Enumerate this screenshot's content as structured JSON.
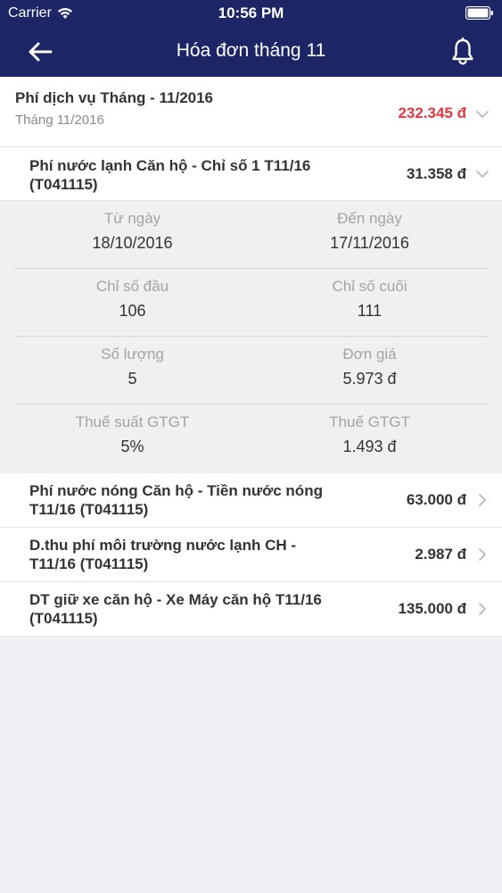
{
  "status_bar": {
    "carrier": "Carrier",
    "time": "10:56 PM"
  },
  "nav": {
    "title": "Hóa đơn tháng 11"
  },
  "section": {
    "title": "Phí dịch vụ Tháng - 11/2016",
    "subtitle": "Tháng 11/2016",
    "amount": "232.345 đ"
  },
  "expanded_item": {
    "name": "Phí nước lạnh Căn hộ - Chỉ số 1 T11/16 (T041115)",
    "amount": "31.358 đ",
    "details": [
      {
        "left_label": "Từ ngày",
        "left_value": "18/10/2016",
        "right_label": "Đến ngày",
        "right_value": "17/11/2016"
      },
      {
        "left_label": "Chỉ số đầu",
        "left_value": "106",
        "right_label": "Chỉ số cuối",
        "right_value": "111"
      },
      {
        "left_label": "Số lượng",
        "left_value": "5",
        "right_label": "Đơn giá",
        "right_value": "5.973 đ"
      },
      {
        "left_label": "Thuế suất GTGT",
        "left_value": "5%",
        "right_label": "Thuế GTGT",
        "right_value": "1.493 đ"
      }
    ]
  },
  "items": [
    {
      "name": "Phí nước nóng Căn hộ - Tiền nước nóng T11/16 (T041115)",
      "amount": "63.000 đ"
    },
    {
      "name": "D.thu phí môi trường nước lạnh CH - T11/16 (T041115)",
      "amount": "2.987 đ"
    },
    {
      "name": "DT giữ xe căn hộ - Xe Máy căn hộ T11/16 (T041115)",
      "amount": "135.000 đ"
    }
  ],
  "colors": {
    "nav_background": "#1c2566",
    "amount_highlight": "#e0383e",
    "page_background": "#efeff4"
  },
  "icons": {
    "back": "arrow-left-icon",
    "notification": "bell-icon",
    "expand": "chevron-down-icon",
    "disclosure": "chevron-right-icon"
  }
}
